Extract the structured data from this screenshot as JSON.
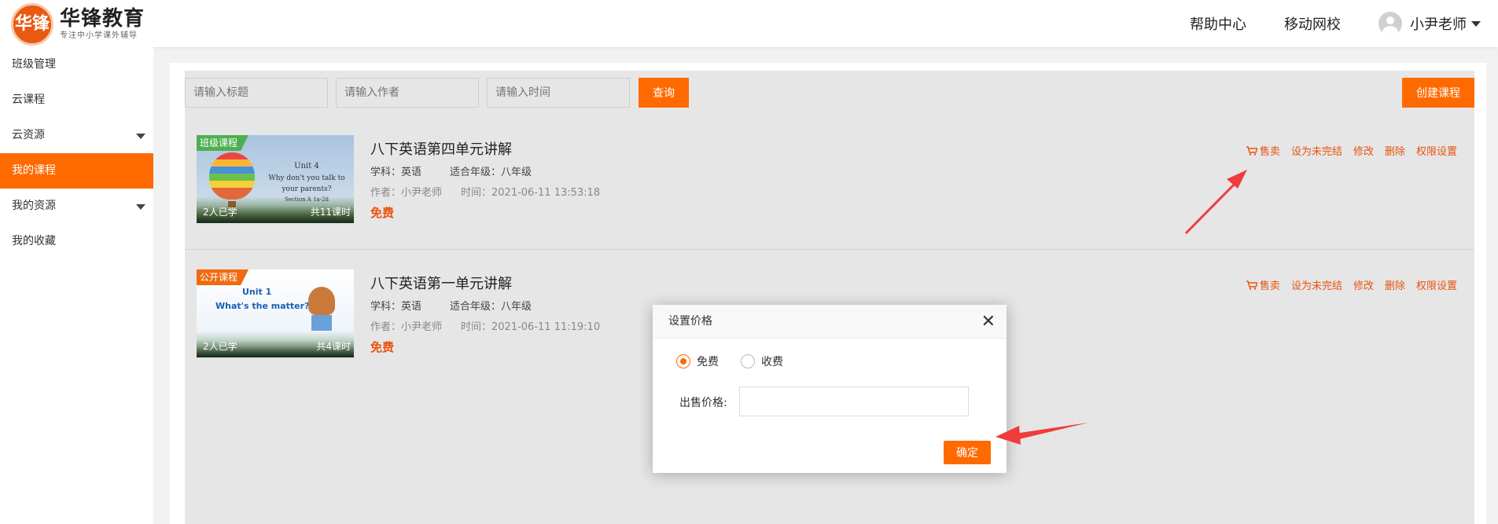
{
  "brand": {
    "logo_char": "华锋",
    "name": "华锋教育",
    "tagline": "专注中小学课外辅导"
  },
  "header": {
    "nav": [
      "帮助中心",
      "移动网校"
    ],
    "user_name": "小尹老师"
  },
  "sidebar": {
    "items": [
      {
        "label": "班级管理",
        "active": false,
        "expandable": false
      },
      {
        "label": "云课程",
        "active": false,
        "expandable": false
      },
      {
        "label": "云资源",
        "active": false,
        "expandable": true
      },
      {
        "label": "我的课程",
        "active": true,
        "expandable": false
      },
      {
        "label": "我的资源",
        "active": false,
        "expandable": true
      },
      {
        "label": "我的收藏",
        "active": false,
        "expandable": false
      }
    ]
  },
  "filters": {
    "title_placeholder": "请输入标题",
    "author_placeholder": "请输入作者",
    "time_placeholder": "请输入时间",
    "query_label": "查询",
    "create_label": "创建课程"
  },
  "courses": [
    {
      "tag": "班级课程",
      "thumb_title": "Unit 4",
      "thumb_line1": "Why don't you talk to",
      "thumb_line2": "your parents?",
      "thumb_line3": "Section A 1a-2d",
      "learned": "2人已学",
      "lessons": "共11课时",
      "title": "八下英语第四单元讲解",
      "subject": "学科：英语",
      "grade": "适合年级：八年级",
      "author": "作者：小尹老师",
      "time": "时间：2021-06-11 13:53:18",
      "price": "免费"
    },
    {
      "tag": "公开课程",
      "thumb_title": "Unit 1",
      "thumb_line1": "What's the matter?",
      "learned": "2人已学",
      "lessons": "共4课时",
      "title": "八下英语第一单元讲解",
      "subject": "学科：英语",
      "grade": "适合年级：八年级",
      "author": "作者：小尹老师",
      "time": "时间：2021-06-11 11:19:10",
      "price": "免费"
    }
  ],
  "actions": {
    "sell": "售卖",
    "set_unfinished": "设为未完结",
    "edit": "修改",
    "delete": "删除",
    "permission": "权限设置"
  },
  "modal": {
    "title": "设置价格",
    "free_label": "免费",
    "paid_label": "收费",
    "selected": "免费",
    "price_label": "出售价格:",
    "price_value": "",
    "confirm_label": "确定"
  },
  "colors": {
    "accent": "#ff6a00",
    "price": "#e8530e",
    "arrow": "#f03c3c"
  }
}
